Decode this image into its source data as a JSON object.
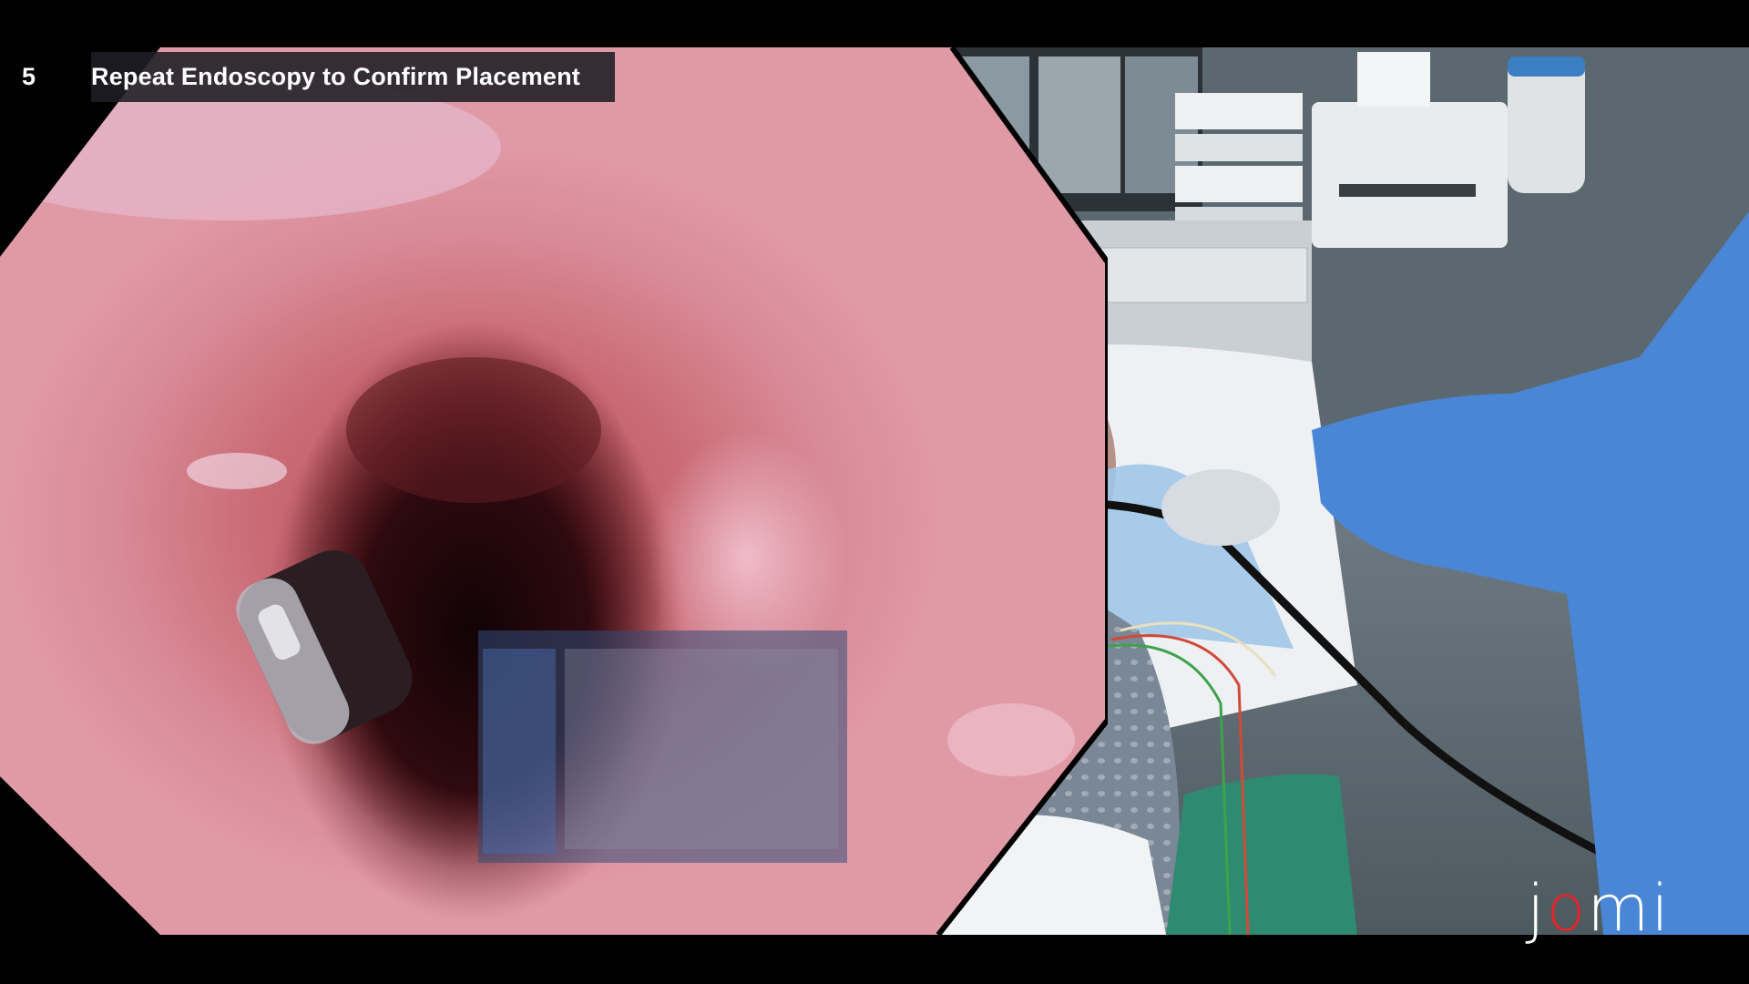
{
  "caption": {
    "step_number": "5",
    "title": "Repeat Endoscopy to Confirm Placement"
  },
  "views": {
    "left": {
      "icon": "endoscopic-view"
    },
    "right": {
      "icon": "operating-room-camera"
    }
  },
  "logo": {
    "text_part1": "j",
    "text_part2": "o",
    "text_part3": "mi",
    "accent_color": "#e0262b"
  },
  "colors": {
    "mucosa": "#d98a95",
    "lumen": "#1a0508",
    "gown": "#4a86d6",
    "drape": "#9ec6e8"
  }
}
